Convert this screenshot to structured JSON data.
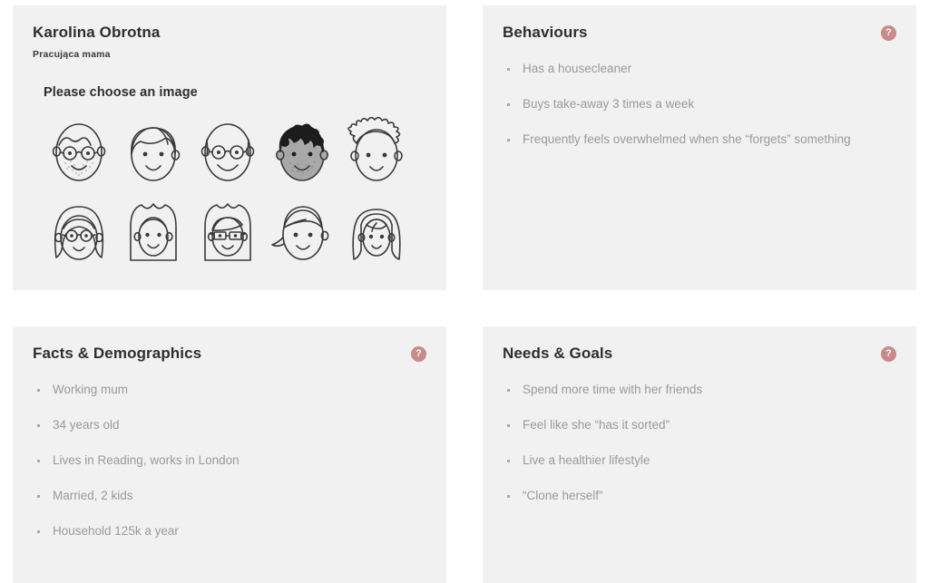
{
  "persona": {
    "name": "Karolina Obrotna",
    "subtitle": "Pracująca mama",
    "choose_image_label": "Please choose an image",
    "avatars": [
      {
        "id": "avatar-1",
        "name": "bald-man-glasses-beard-avatar",
        "selected": false
      },
      {
        "id": "avatar-2",
        "name": "short-hair-man-avatar",
        "selected": false
      },
      {
        "id": "avatar-3",
        "name": "bald-man-glasses-avatar",
        "selected": false
      },
      {
        "id": "avatar-4",
        "name": "curly-hair-man-avatar",
        "selected": true
      },
      {
        "id": "avatar-5",
        "name": "spiky-hair-man-avatar",
        "selected": false
      },
      {
        "id": "avatar-6",
        "name": "long-hair-woman-glasses-avatar",
        "selected": false
      },
      {
        "id": "avatar-7",
        "name": "straight-hair-woman-avatar",
        "selected": false
      },
      {
        "id": "avatar-8",
        "name": "woman-rectangular-glasses-avatar",
        "selected": false
      },
      {
        "id": "avatar-9",
        "name": "ponytail-woman-avatar",
        "selected": false
      },
      {
        "id": "avatar-10",
        "name": "long-blonde-woman-avatar",
        "selected": false
      }
    ]
  },
  "behaviours": {
    "title": "Behaviours",
    "help_label": "?",
    "items": [
      "Has a housecleaner",
      "Buys take-away 3 times a week",
      "Frequently feels overwhelmed when she “forgets” something"
    ]
  },
  "facts": {
    "title": "Facts & Demographics",
    "help_label": "?",
    "items": [
      "Working mum",
      "34 years old",
      "Lives in Reading, works in London",
      "Married, 2 kids",
      "Household 125k a year"
    ]
  },
  "needs": {
    "title": "Needs & Goals",
    "help_label": "?",
    "items": [
      "Spend more time with her friends",
      "Feel like she “has it sorted”",
      "Live a healthier lifestyle",
      "“Clone herself”"
    ]
  },
  "colors": {
    "panel_background": "#f1f1f1",
    "page_background": "#ffffff",
    "help_icon": "#c98a8a",
    "title_text": "#2e2e2e",
    "body_text": "#9a9a9a",
    "avatar_line": "#3a3a3a",
    "avatar_selected_fill": "#a8a8a8",
    "avatar_selected_hair": "#1c1c1c"
  }
}
